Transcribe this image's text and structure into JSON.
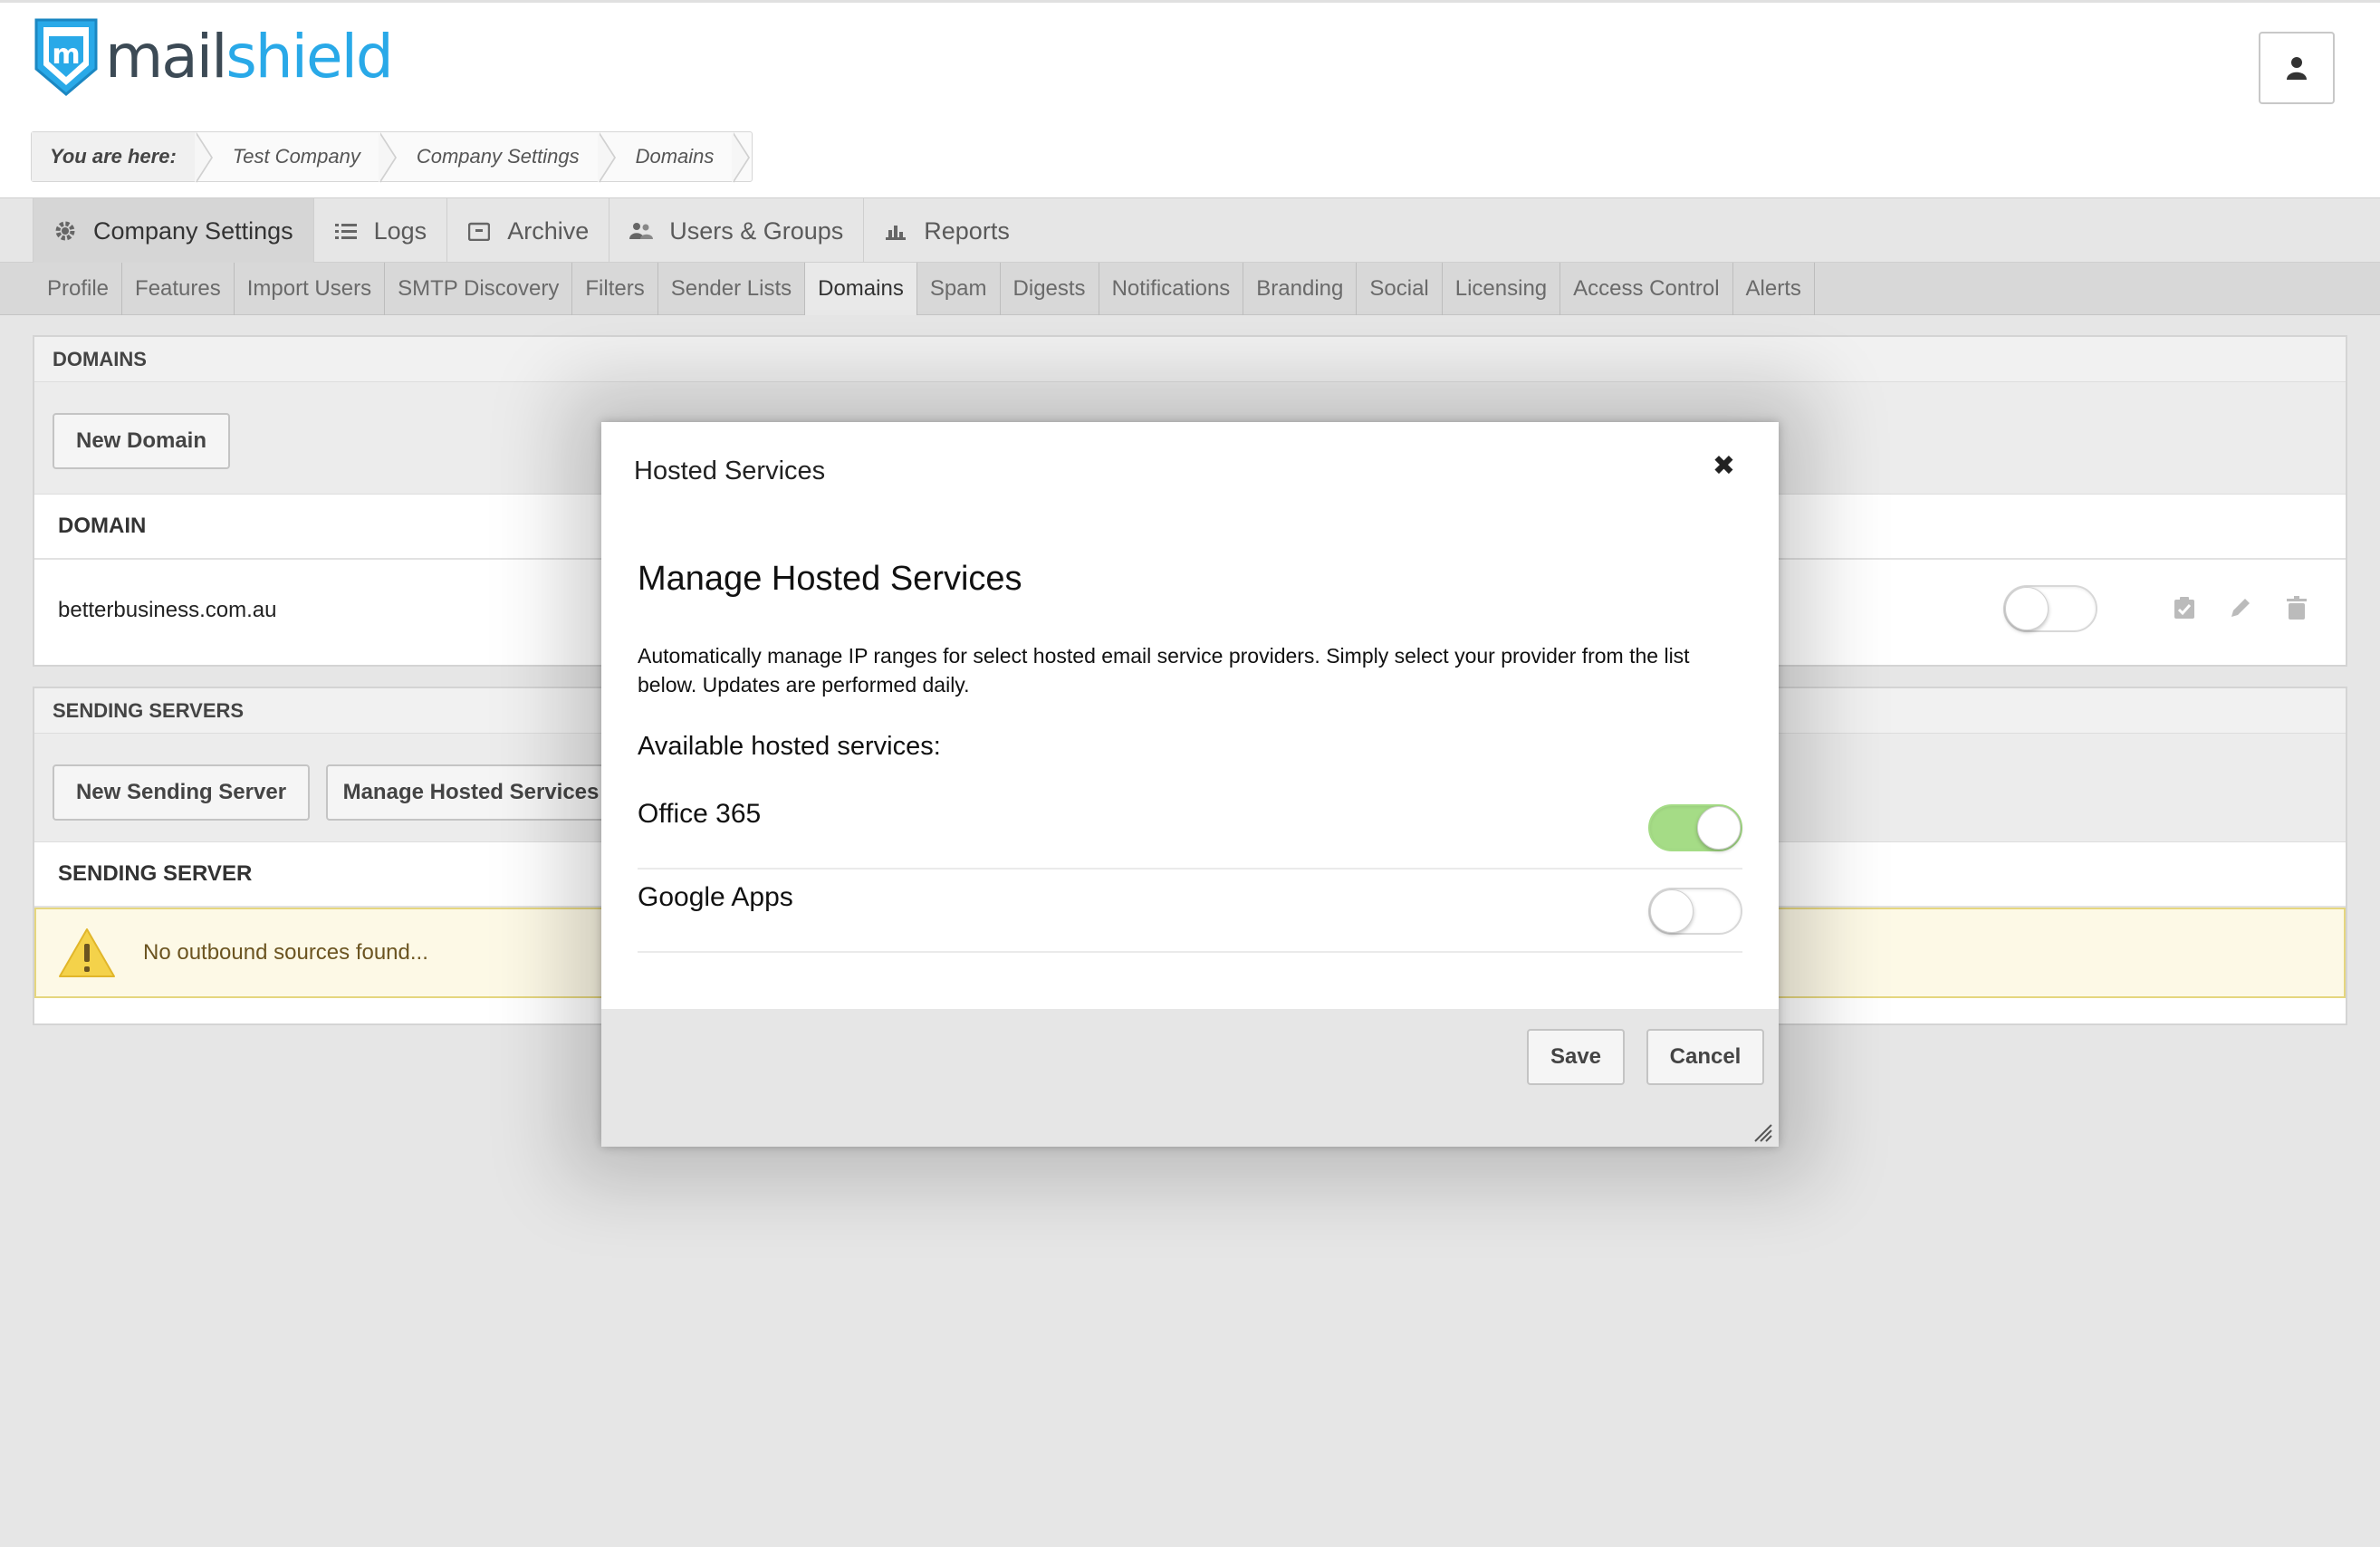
{
  "brand": {
    "mail": "mail",
    "shield": "shield",
    "accent": "#29a9e8"
  },
  "breadcrumb": {
    "prefix": "You are here:",
    "items": [
      "Test Company",
      "Company Settings",
      "Domains"
    ]
  },
  "main_nav": [
    {
      "label": "Company Settings",
      "icon": "gear-icon",
      "active": true
    },
    {
      "label": "Logs",
      "icon": "list-icon",
      "active": false
    },
    {
      "label": "Archive",
      "icon": "archive-icon",
      "active": false
    },
    {
      "label": "Users & Groups",
      "icon": "users-icon",
      "active": false
    },
    {
      "label": "Reports",
      "icon": "chart-icon",
      "active": false
    }
  ],
  "sub_nav": [
    "Profile",
    "Features",
    "Import Users",
    "SMTP Discovery",
    "Filters",
    "Sender Lists",
    "Domains",
    "Spam",
    "Digests",
    "Notifications",
    "Branding",
    "Social",
    "Licensing",
    "Access Control",
    "Alerts"
  ],
  "sub_nav_active": "Domains",
  "domains_panel": {
    "title": "DOMAINS",
    "new_button": "New Domain",
    "column": "DOMAIN",
    "rows": [
      {
        "name": "betterbusiness.com.au",
        "enabled": false
      }
    ]
  },
  "sending_panel": {
    "title": "SENDING SERVERS",
    "new_button": "New Sending Server",
    "manage_button": "Manage Hosted Services",
    "column": "SENDING SERVER",
    "warning": "No outbound sources found..."
  },
  "modal": {
    "title": "Hosted Services",
    "close": "✖",
    "heading": "Manage Hosted Services",
    "description": "Automatically manage IP ranges for select hosted email service providers. Simply select your provider from the list below. Updates are performed daily.",
    "available_label": "Available hosted services:",
    "services": [
      {
        "name": "Office 365",
        "enabled": true
      },
      {
        "name": "Google Apps",
        "enabled": false
      }
    ],
    "save": "Save",
    "cancel": "Cancel"
  }
}
